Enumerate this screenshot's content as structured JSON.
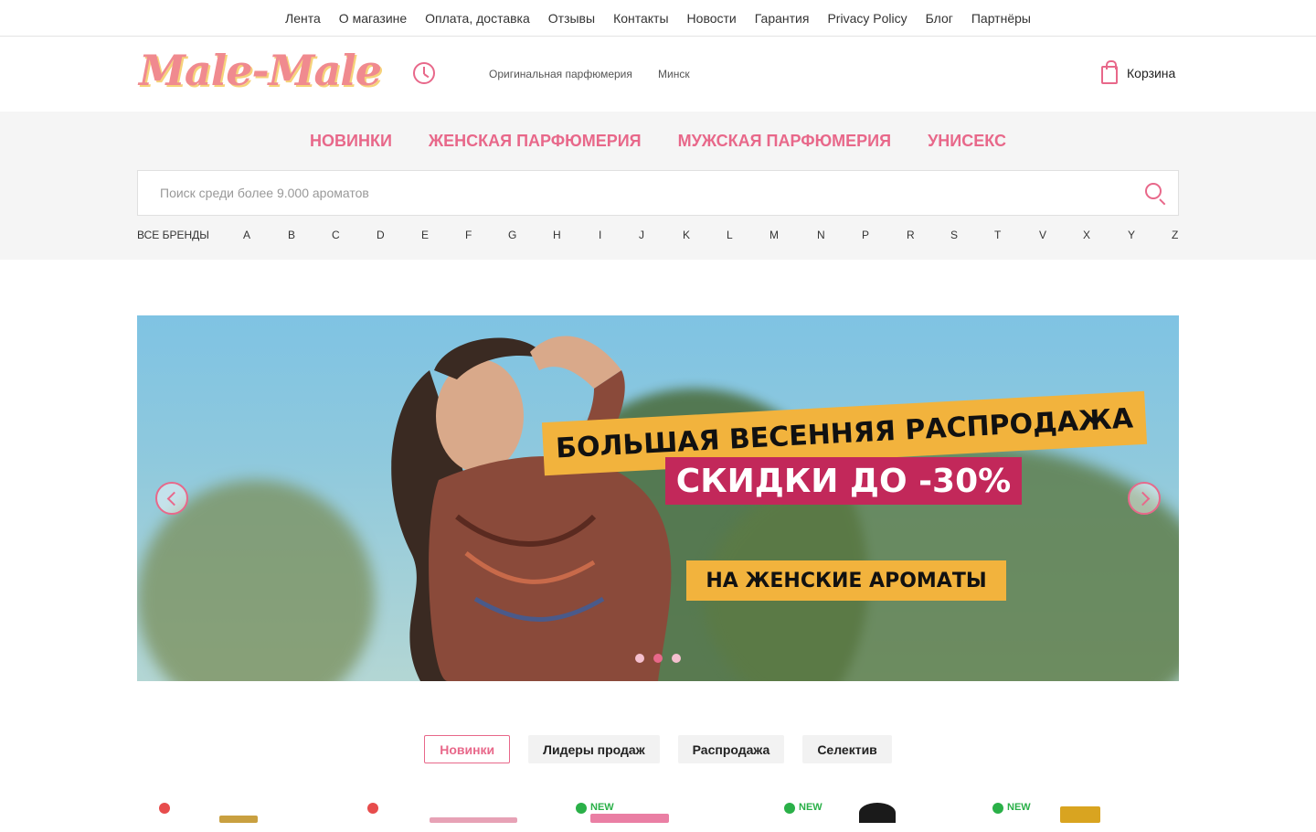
{
  "topnav": [
    "Лента",
    "О магазине",
    "Оплата, доставка",
    "Отзывы",
    "Контакты",
    "Новости",
    "Гарантия",
    "Privacy Policy",
    "Блог",
    "Партнёры"
  ],
  "header": {
    "logo": "Male-Male",
    "tagline": "Оригинальная парфюмерия",
    "city": "Минск",
    "cart": "Корзина"
  },
  "categories": [
    "НОВИНКИ",
    "ЖЕНСКАЯ ПАРФЮМЕРИЯ",
    "МУЖСКАЯ ПАРФЮМЕРИЯ",
    "УНИСЕКС"
  ],
  "search": {
    "placeholder": "Поиск среди более 9.000 ароматов"
  },
  "alphabet": {
    "all": "ВСЕ БРЕНДЫ",
    "letters": [
      "A",
      "B",
      "C",
      "D",
      "E",
      "F",
      "G",
      "H",
      "I",
      "J",
      "K",
      "L",
      "M",
      "N",
      "P",
      "R",
      "S",
      "T",
      "V",
      "X",
      "Y",
      "Z"
    ]
  },
  "banner": {
    "line1": "БОЛЬШАЯ ВЕСЕННЯЯ РАСПРОДАЖА",
    "line2": "СКИДКИ ДО -30%",
    "line3": "НА ЖЕНСКИЕ АРОМАТЫ",
    "slides": 3,
    "active_slide": 2
  },
  "tabs": [
    "Новинки",
    "Лидеры продаж",
    "Распродажа",
    "Селектив"
  ],
  "products": [
    {
      "badge": "",
      "dot": "#e74c4c"
    },
    {
      "badge": "",
      "dot": "#e74c4c"
    },
    {
      "badge": "NEW",
      "dot": "#2ab048"
    },
    {
      "badge": "NEW",
      "dot": "#2ab048"
    },
    {
      "badge": "NEW",
      "dot": "#2ab048"
    }
  ],
  "colors": {
    "accent": "#e8688a",
    "banner_yellow": "#f2b33d",
    "banner_magenta": "#c2285a"
  }
}
